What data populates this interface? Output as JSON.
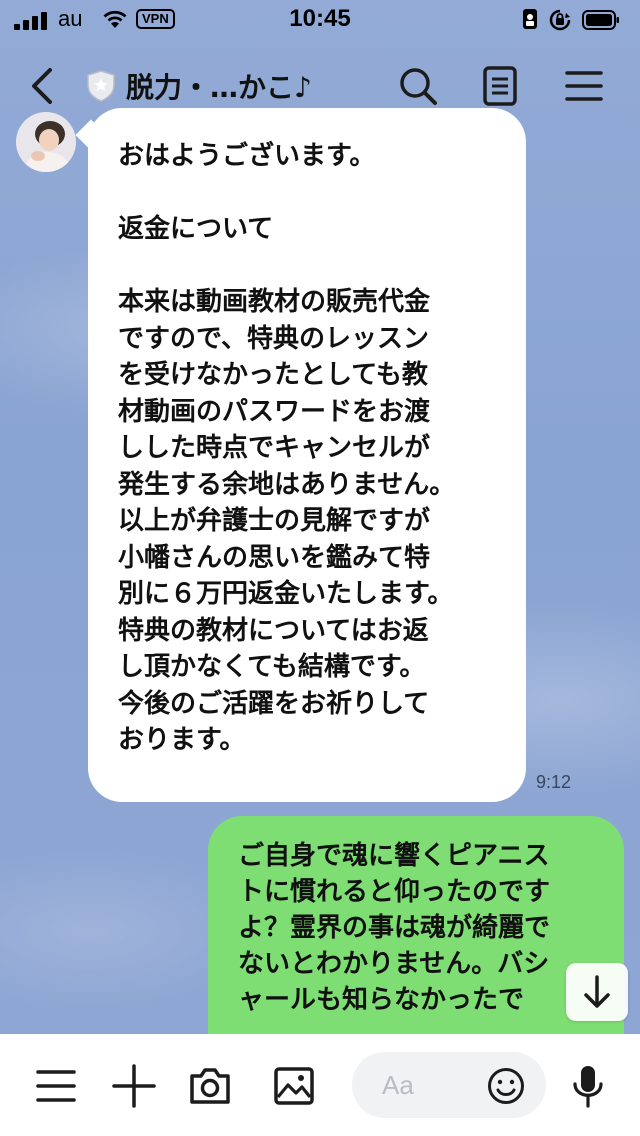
{
  "status_bar": {
    "carrier": "au",
    "vpn": "VPN",
    "time": "10:45"
  },
  "header": {
    "title": "脱力・…かこ♪"
  },
  "messages": [
    {
      "direction": "incoming",
      "text": "おはようございます。\n\n返金について\n\n本来は動画教材の販売代金\nですので、特典のレッスン\nを受けなかったとしても教\n材動画のパスワードをお渡\nしした時点でキャンセルが\n発生する余地はありません。\n以上が弁護士の見解ですが\n小幡さんの思いを鑑みて特\n別に６万円返金いたします。\n特典の教材についてはお返\nし頂かなくても結構です。\n今後のご活躍をお祈りして\nおります。",
      "time": "9:12"
    },
    {
      "direction": "outgoing",
      "text": "ご自身で魂に響くピアニス\nトに慣れると仰ったのです\nよ？霊界の事は魂が綺麗で\nないとわかりません。バシ\nャールも知らなかったで"
    }
  ],
  "input": {
    "placeholder": "Aa"
  },
  "colors": {
    "chat_background": "#8fa8d6",
    "incoming_bubble": "#ffffff",
    "outgoing_bubble": "#7ede73"
  },
  "icons": {
    "header": [
      "back-chevron-icon",
      "shield-icon",
      "search-icon",
      "notes-icon",
      "menu-icon"
    ],
    "toolbar": [
      "menu-icon",
      "plus-icon",
      "camera-icon",
      "image-icon",
      "emoji-icon",
      "microphone-icon"
    ]
  }
}
